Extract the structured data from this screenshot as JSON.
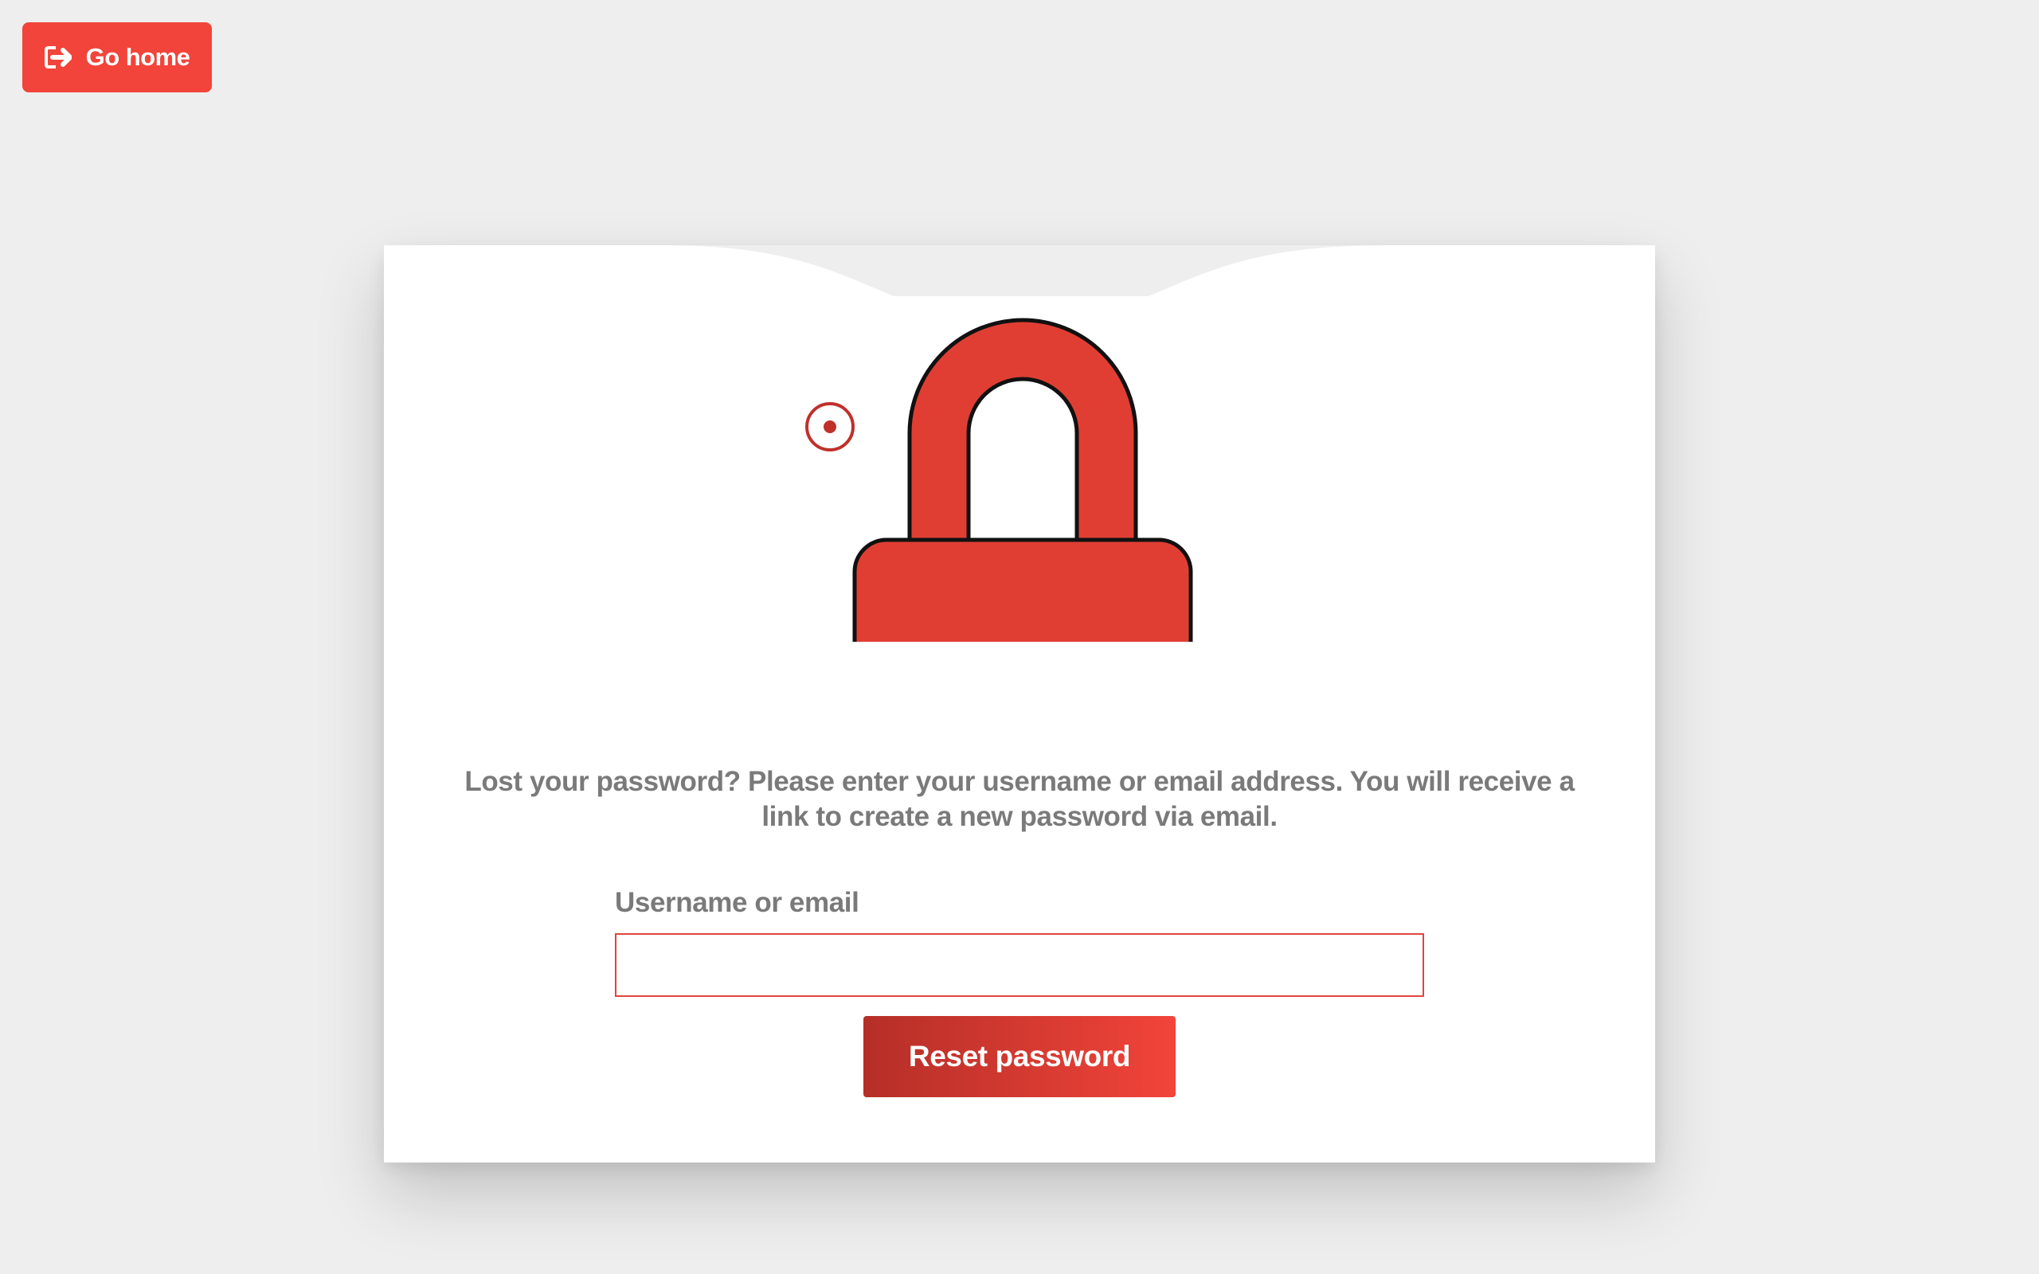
{
  "header": {
    "home_label": "Go home",
    "home_icon": "sign-out-icon"
  },
  "card": {
    "lock_icon": "padlock-icon",
    "target_icon": "radio-target-icon",
    "description": "Lost your password? Please enter your username or email address. You will receive a link to create a new password via email.",
    "field_label": "Username or email",
    "field_value": "",
    "field_placeholder": "",
    "submit_label": "Reset password"
  },
  "colors": {
    "accent": "#f2443a",
    "lock_fill": "#e03e33",
    "text_muted": "#7a7a7a",
    "background": "#eeeeee"
  }
}
